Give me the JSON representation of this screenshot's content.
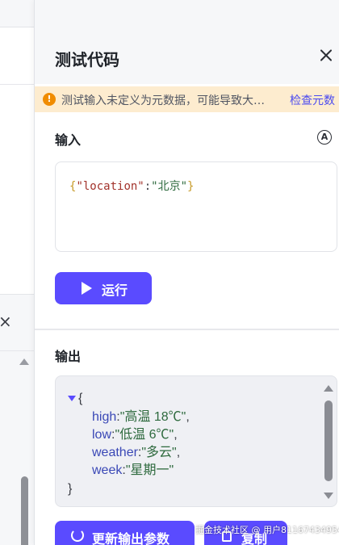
{
  "panel": {
    "title": "测试代码",
    "warning_text": "测试输入未定义为元数据，可能导致大…",
    "warning_link": "检查元数",
    "input_label": "输入",
    "input_json": {
      "open_brace": "{",
      "key": "\"location\"",
      "colon": ":",
      "value": "\"北京\"",
      "close_brace": "}"
    },
    "run_button": "运行",
    "output_label": "输出",
    "output_json": {
      "open": "{",
      "rows": [
        {
          "key": "high",
          "value": "\"高温 18℃\"",
          "suffix": ","
        },
        {
          "key": "low",
          "value": "\"低温 6℃\"",
          "suffix": ","
        },
        {
          "key": "weather",
          "value": "\"多云\"",
          "suffix": ","
        },
        {
          "key": "week",
          "value": "\"星期一\"",
          "suffix": ""
        }
      ],
      "close": "}"
    },
    "update_button": "更新输出参数",
    "copy_button": "复制"
  },
  "watermark": "掘金技术社区 @ 用户81167434954",
  "colors": {
    "accent": "#5a4bff",
    "warning_bg": "#fdeccf",
    "warning_icon": "#f08c00"
  },
  "icons": [
    "close-icon",
    "warning-icon",
    "ai-icon",
    "play-icon",
    "refresh-icon",
    "copy-icon",
    "chevron-down-icon"
  ]
}
